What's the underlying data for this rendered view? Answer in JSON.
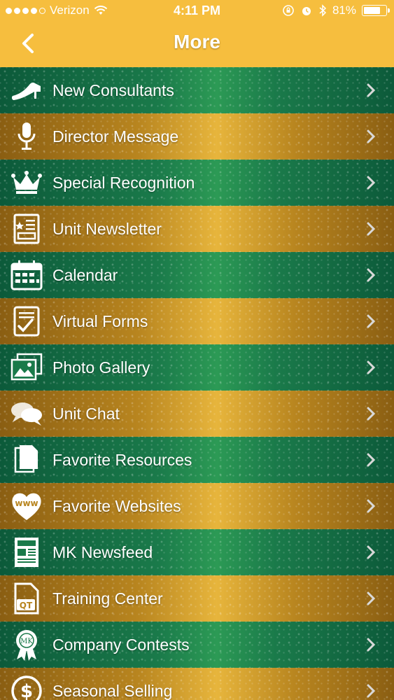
{
  "status_bar": {
    "carrier": "Verizon",
    "time": "4:11 PM",
    "battery": "81%",
    "battery_level": 0.81
  },
  "nav": {
    "title": "More",
    "back_icon": "chevron-left-icon"
  },
  "colors": {
    "header": "#f6be3e",
    "green_row": "#1a7a4a",
    "gold_row": "#b8851f",
    "text": "#ffffff"
  },
  "menu": {
    "items": [
      {
        "label": "New Consultants",
        "icon": "high-heel-icon"
      },
      {
        "label": "Director Message",
        "icon": "microphone-icon"
      },
      {
        "label": "Special Recognition",
        "icon": "crown-icon"
      },
      {
        "label": "Unit Newsletter",
        "icon": "newsletter-icon"
      },
      {
        "label": "Calendar",
        "icon": "calendar-icon"
      },
      {
        "label": "Virtual Forms",
        "icon": "checklist-icon"
      },
      {
        "label": "Photo Gallery",
        "icon": "photos-icon"
      },
      {
        "label": "Unit Chat",
        "icon": "chat-bubbles-icon"
      },
      {
        "label": "Favorite Resources",
        "icon": "documents-icon"
      },
      {
        "label": "Favorite Websites",
        "icon": "www-heart-icon"
      },
      {
        "label": "MK Newsfeed",
        "icon": "newspaper-icon"
      },
      {
        "label": "Training Center",
        "icon": "qt-document-icon"
      },
      {
        "label": "Company Contests",
        "icon": "mk-ribbon-icon"
      },
      {
        "label": "Seasonal Selling",
        "icon": "dollar-icon"
      }
    ]
  }
}
